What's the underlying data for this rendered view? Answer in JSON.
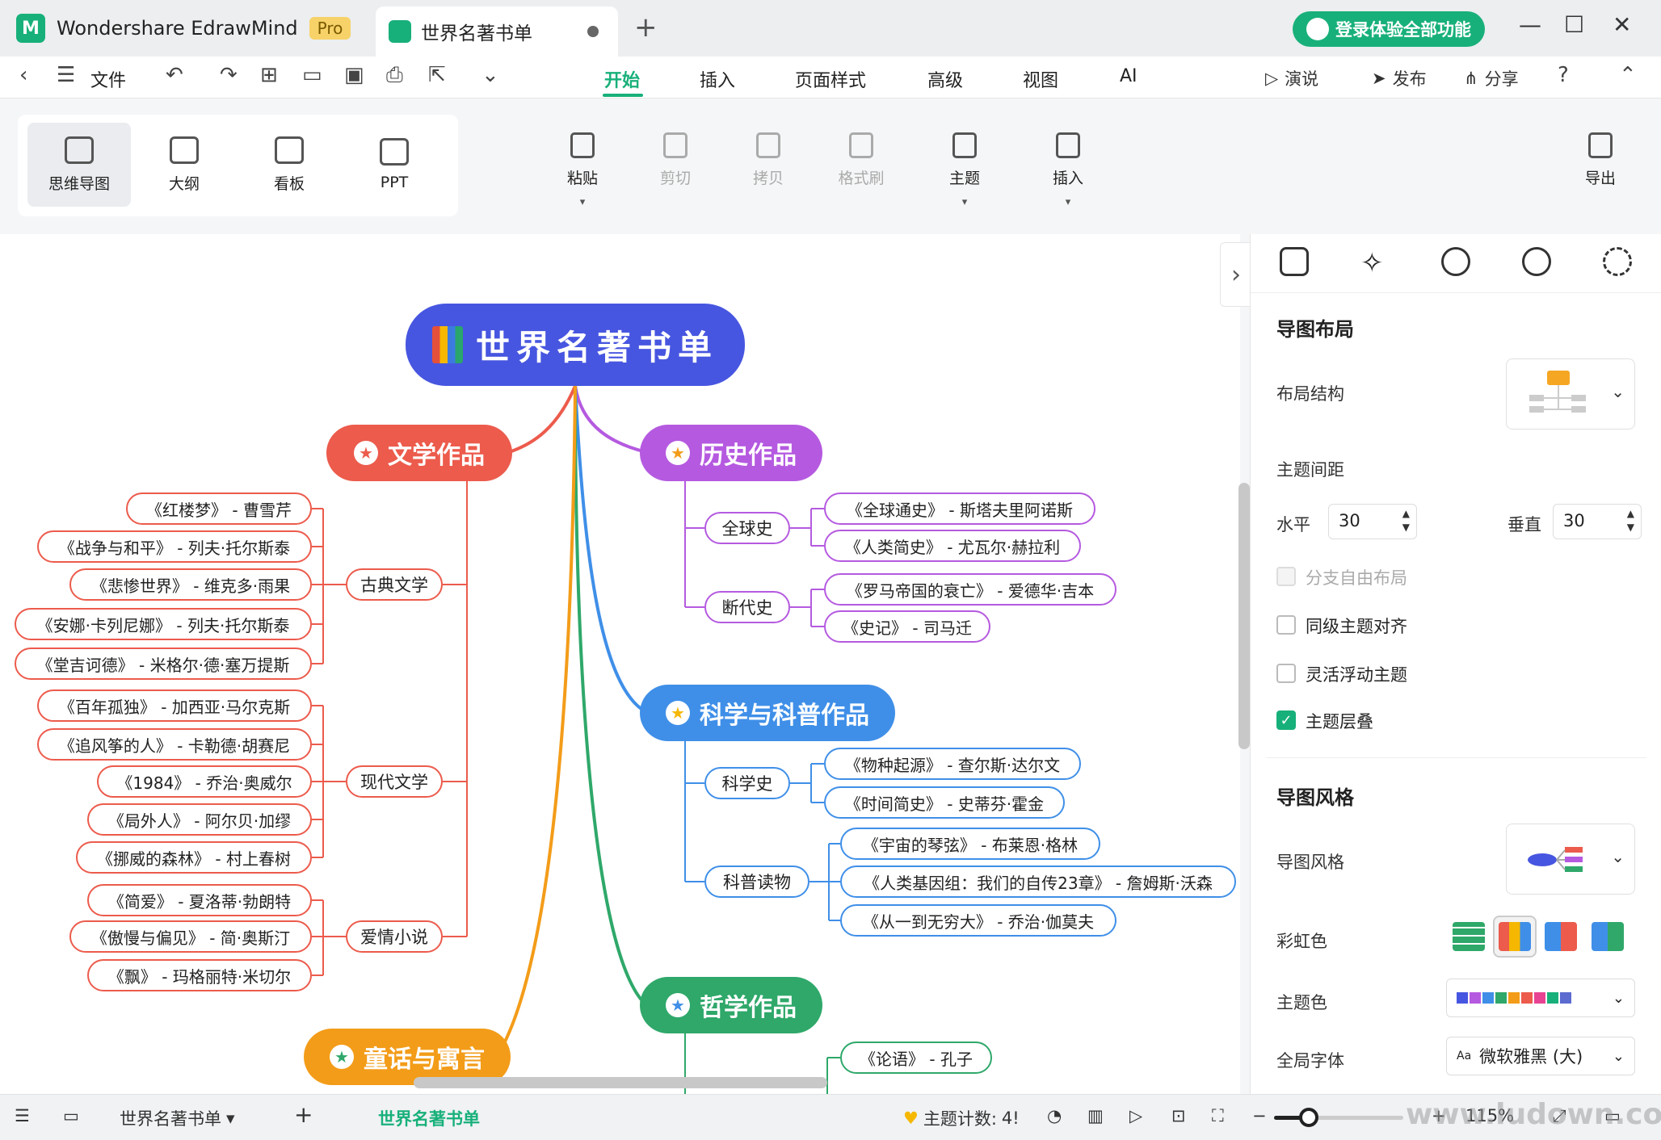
{
  "titlebar": {
    "app_name": "Wondershare EdrawMind",
    "pro_badge": "Pro",
    "doc_tab_title": "世界名著书单",
    "login_button": "登录体验全部功能"
  },
  "menubar": {
    "file_label": "文件",
    "tabs": [
      "开始",
      "插入",
      "页面样式",
      "高级",
      "视图",
      "AI"
    ],
    "active_tab": "开始",
    "present_label": "演说",
    "publish_label": "发布",
    "share_label": "分享"
  },
  "ribbon": {
    "views": [
      {
        "label": "思维导图",
        "icon": "mindmap-icon",
        "active": true
      },
      {
        "label": "大纲",
        "icon": "outline-icon",
        "active": false
      },
      {
        "label": "看板",
        "icon": "kanban-icon",
        "active": false
      },
      {
        "label": "PPT",
        "icon": "ppt-icon",
        "active": false
      }
    ],
    "buttons": [
      {
        "label": "粘贴",
        "icon": "paste-icon",
        "enabled": true
      },
      {
        "label": "剪切",
        "icon": "cut-icon",
        "enabled": false
      },
      {
        "label": "拷贝",
        "icon": "copy-icon",
        "enabled": false
      },
      {
        "label": "格式刷",
        "icon": "format-painter-icon",
        "enabled": false
      },
      {
        "label": "主题",
        "icon": "topic-icon",
        "enabled": true
      },
      {
        "label": "插入",
        "icon": "insert-icon",
        "enabled": true
      }
    ],
    "export_label": "导出"
  },
  "mindmap": {
    "root": "世界名著书单",
    "colors": {
      "root": "#4756e0",
      "literature": "#ec5b4c",
      "history": "#b55ae0",
      "science": "#3f8fe8",
      "philosophy": "#2fa86a",
      "fairy": "#f39c19"
    },
    "literature": {
      "title": "文学作品",
      "groups": [
        {
          "name": "古典文学",
          "books": [
            "《红楼梦》 - 曹雪芹",
            "《战争与和平》 - 列夫·托尔斯泰",
            "《悲惨世界》 - 维克多·雨果",
            "《安娜·卡列尼娜》 - 列夫·托尔斯泰",
            "《堂吉诃德》 - 米格尔·德·塞万提斯"
          ]
        },
        {
          "name": "现代文学",
          "books": [
            "《百年孤独》 - 加西亚·马尔克斯",
            "《追风筝的人》 - 卡勒德·胡赛尼",
            "《1984》 - 乔治·奥威尔",
            "《局外人》 - 阿尔贝·加缪",
            "《挪威的森林》 - 村上春树"
          ]
        },
        {
          "name": "爱情小说",
          "books": [
            "《简爱》 - 夏洛蒂·勃朗特",
            "《傲慢与偏见》 - 简·奥斯汀",
            "《飘》 - 玛格丽特·米切尔"
          ]
        }
      ]
    },
    "history": {
      "title": "历史作品",
      "groups": [
        {
          "name": "全球史",
          "books": [
            "《全球通史》 - 斯塔夫里阿诺斯",
            "《人类简史》 - 尤瓦尔·赫拉利"
          ]
        },
        {
          "name": "断代史",
          "books": [
            "《罗马帝国的衰亡》 - 爱德华·吉本",
            "《史记》 - 司马迁"
          ]
        }
      ]
    },
    "science": {
      "title": "科学与科普作品",
      "groups": [
        {
          "name": "科学史",
          "books": [
            "《物种起源》 - 查尔斯·达尔文",
            "《时间简史》 - 史蒂芬·霍金"
          ]
        },
        {
          "name": "科普读物",
          "books": [
            "《宇宙的琴弦》 - 布莱恩·格林",
            "《人类基因组：我们的自传23章》 - 詹姆斯·沃森",
            "《从一到无穷大》 - 乔治·伽莫夫"
          ]
        }
      ]
    },
    "philosophy": {
      "title": "哲学作品",
      "books": [
        "《论语》 - 孔子"
      ]
    },
    "fairy": {
      "title": "童话与寓言"
    }
  },
  "panel": {
    "layout_title": "导图布局",
    "layout_structure_label": "布局结构",
    "spacing_label": "主题间距",
    "horizontal_label": "水平",
    "horizontal_value": "30",
    "vertical_label": "垂直",
    "vertical_value": "30",
    "checkboxes": [
      {
        "label": "分支自由布局",
        "checked": false,
        "disabled": true
      },
      {
        "label": "同级主题对齐",
        "checked": false,
        "disabled": false
      },
      {
        "label": "灵活浮动主题",
        "checked": false,
        "disabled": false
      },
      {
        "label": "主题层叠",
        "checked": true,
        "disabled": false
      }
    ],
    "style_title": "导图风格",
    "style_label": "导图风格",
    "rainbow_label": "彩虹色",
    "theme_color_label": "主题色",
    "font_label": "全局字体",
    "font_value": "微软雅黑 (大)",
    "font_prefix": "Aa"
  },
  "statusbar": {
    "page_name": "世界名著书单",
    "active_page": "世界名著书单",
    "topic_count_label": "主题计数:",
    "topic_count_value": "4!",
    "zoom_value": "115%",
    "zoom_fraction": 0.27
  },
  "watermark": "www.ludown.com"
}
